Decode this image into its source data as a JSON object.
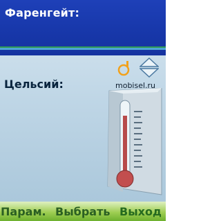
{
  "fahrenheit": {
    "label": "Фаренгейт:",
    "value": ""
  },
  "celsius": {
    "label": "Цельсий:"
  },
  "watermark": {
    "text": "mobisel.ru"
  },
  "softkeys": {
    "left": "Парам.",
    "middle": "Выбрать",
    "right": "Выход"
  },
  "icons": [
    "arrow-up-icon",
    "arrow-down-icon",
    "thermometer-icon"
  ],
  "colors": {
    "top_panel": "#1737a9",
    "softkey_bar": "#6db02e",
    "label_dark": "#09243e"
  }
}
